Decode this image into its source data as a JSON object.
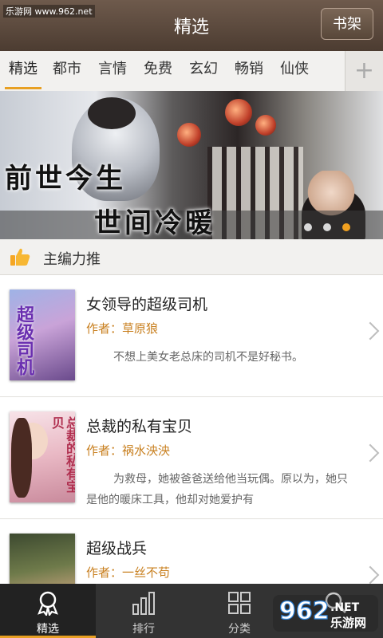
{
  "header": {
    "watermark": "乐游网 www.962.net",
    "title": "精选",
    "shelf_button": "书架"
  },
  "tabs": {
    "items": [
      "精选",
      "都市",
      "言情",
      "免费",
      "玄幻",
      "畅销",
      "仙侠"
    ],
    "active_index": 0,
    "add": "+"
  },
  "banner": {
    "caption_line1": "前世今生",
    "caption_line2": "世间冷暖",
    "dots": 3,
    "active_dot": 2
  },
  "section": {
    "label": "主编力推"
  },
  "books": [
    {
      "title": "女领导的超级司机",
      "author": "作者：草原狼",
      "description": "不想上美女老总床的司机不是好秘书。",
      "cover_text": "超级司机"
    },
    {
      "title": "总裁的私有宝贝",
      "author": "作者：祸水泱泱",
      "description": "为救母，她被爸爸送给他当玩偶。原以为，她只是他的暖床工具，他却对她爱护有",
      "cover_text": "总裁的私有宝贝"
    },
    {
      "title": "超级战兵",
      "author": "作者：一丝不苟",
      "description": "",
      "cover_text": ""
    }
  ],
  "bottom_nav": {
    "items": [
      "精选",
      "排行",
      "分类"
    ],
    "active_index": 0
  },
  "brand": {
    "logo_text": "962",
    "logo_sub": ".NET",
    "logo_cn": "乐游网"
  },
  "colors": {
    "accent": "#e8a023",
    "author": "#c87f1e",
    "header": "#5a4839"
  }
}
